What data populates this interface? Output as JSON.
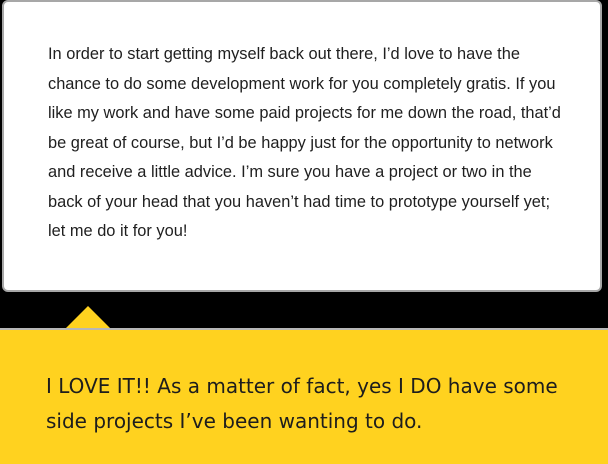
{
  "email": {
    "body": "In order to start getting myself back out there, I’d love to have the chance to do some development work for you completely gratis. If you like my work and have some paid projects for me down the road, that’d be great of course, but I’d be happy just for the opportunity to network and receive a little advice. I’m sure you have a project or two in the back of your head that you haven’t had time to prototype yourself yet; let me do it for you!"
  },
  "reply": {
    "text": "I LOVE IT!! As a matter of fact, yes I DO have some side projects I’ve been wanting to do."
  },
  "colors": {
    "reply_background": "#ffd21f",
    "card_border": "#a7a7a7",
    "background": "#000000"
  }
}
